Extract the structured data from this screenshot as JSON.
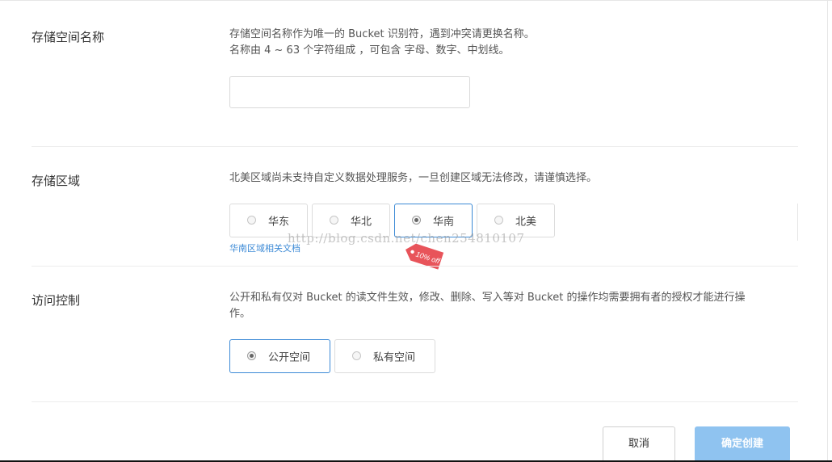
{
  "bucket_name": {
    "label": "存储空间名称",
    "desc_line1": "存储空间名称作为唯一的 Bucket 识别符，遇到冲突请更换名称。",
    "desc_line2": "名称由 4 ~ 63 个字符组成 ，可包含 字母、数字、中划线。",
    "input_value": "",
    "input_placeholder": ""
  },
  "region": {
    "label": "存储区域",
    "desc": "北美区域尚未支持自定义数据处理服务，一旦创建区域无法修改，请谨慎选择。",
    "options": [
      "华东",
      "华北",
      "华南",
      "北美"
    ],
    "selected": "华南",
    "doc_link": "华南区域相关文档",
    "promo_tag": "10% off"
  },
  "access": {
    "label": "访问控制",
    "desc_line1": "公开和私有仅对 Bucket 的读文件生效，修改、删除、写入等对 Bucket 的操作均需要拥有者的授权才能进行操",
    "desc_line2": "作。",
    "options": [
      "公开空间",
      "私有空间"
    ],
    "selected": "公开空间"
  },
  "actions": {
    "cancel_label": "取消",
    "confirm_label": "确定创建"
  },
  "watermark": "http://blog.csdn.net/chen254810107",
  "colors": {
    "accent": "#3c8ad6",
    "confirm_bg": "#8fc3f0",
    "promo_red": "#e8545a"
  }
}
